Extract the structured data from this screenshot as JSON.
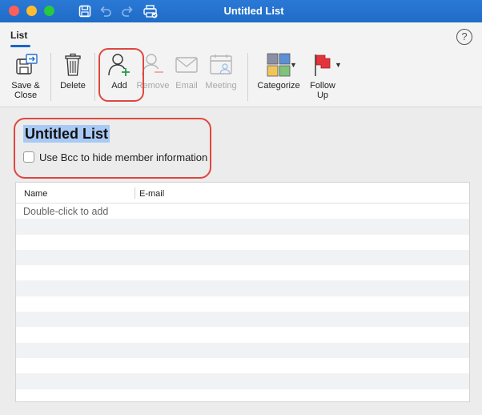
{
  "window": {
    "title": "Untitled List"
  },
  "tabs": {
    "active": "List"
  },
  "ribbon": {
    "save_close": "Save & Close",
    "delete": "Delete",
    "add": "Add",
    "remove": "Remove",
    "email": "Email",
    "meeting": "Meeting",
    "categorize": "Categorize",
    "follow_up": "Follow Up"
  },
  "form": {
    "list_name": "Untitled List",
    "bcc_label": "Use Bcc to hide member information",
    "bcc_checked": false
  },
  "table": {
    "columns": [
      "Name",
      "E-mail"
    ],
    "placeholder": "Double-click to add"
  },
  "colors": {
    "titlebar": "#1f6cc6",
    "accent": "#1a66c9",
    "highlight": "#a9c9f5",
    "annotation": "#e0463f"
  },
  "icons": [
    "save-icon",
    "undo-icon",
    "redo-icon",
    "print-icon",
    "help-icon",
    "save-close-icon",
    "trash-icon",
    "add-person-icon",
    "remove-person-icon",
    "envelope-icon",
    "calendar-people-icon",
    "category-grid-icon",
    "flag-icon"
  ]
}
